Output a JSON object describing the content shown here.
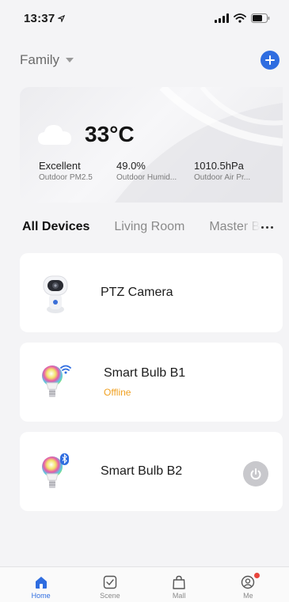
{
  "status_bar": {
    "time": "13:37"
  },
  "header": {
    "home_name": "Family"
  },
  "weather": {
    "temperature": "33°C",
    "stats": [
      {
        "value": "Excellent",
        "label": "Outdoor PM2.5"
      },
      {
        "value": "49.0%",
        "label": "Outdoor Humid..."
      },
      {
        "value": "1010.5hPa",
        "label": "Outdoor Air Pr..."
      }
    ]
  },
  "tabs": [
    {
      "label": "All Devices",
      "active": true
    },
    {
      "label": "Living Room",
      "active": false
    },
    {
      "label": "Master Bedroom",
      "active": false
    }
  ],
  "devices": [
    {
      "name": "PTZ Camera",
      "status": "",
      "icon": "camera-icon"
    },
    {
      "name": "Smart Bulb B1",
      "status": "Offline",
      "icon": "bulb-wifi-icon"
    },
    {
      "name": "Smart Bulb B2",
      "status": "",
      "icon": "bulb-bluetooth-icon"
    }
  ],
  "nav": [
    {
      "label": "Home",
      "icon": "home-icon",
      "active": true
    },
    {
      "label": "Scene",
      "icon": "scene-icon",
      "active": false
    },
    {
      "label": "Mall",
      "icon": "bag-icon",
      "active": false
    },
    {
      "label": "Me",
      "icon": "profile-icon",
      "active": false,
      "badge": true
    }
  ],
  "colors": {
    "accent": "#2f6de0",
    "offline": "#f0a020",
    "badge": "#e8453c"
  }
}
